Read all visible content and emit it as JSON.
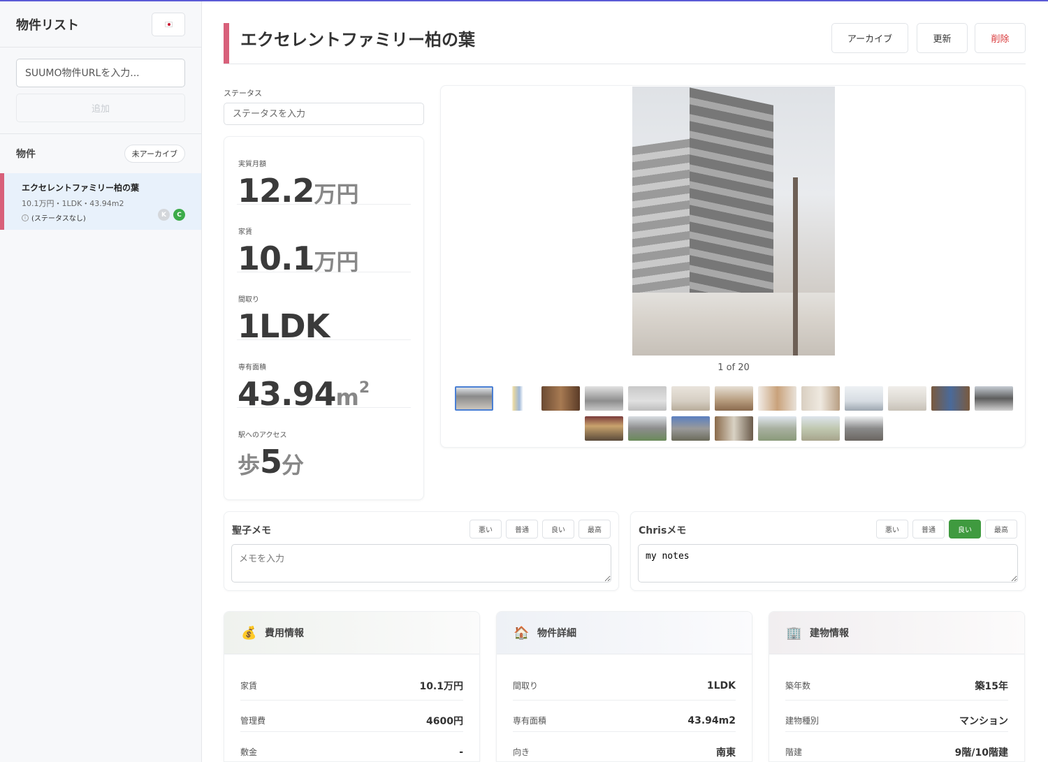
{
  "sidebar": {
    "title": "物件リスト",
    "url_placeholder": "SUUMO物件URLを入力...",
    "add_label": "追加",
    "section_title": "物件",
    "filter_label": "未アーカイブ",
    "items": [
      {
        "name": "エクセレントファミリー柏の葉",
        "meta": "10.1万円・1LDK・43.94m2",
        "status": "(ステータスなし)",
        "badges": [
          "K",
          "C"
        ]
      }
    ]
  },
  "header": {
    "title": "エクセレントファミリー柏の葉",
    "archive_label": "アーカイブ",
    "update_label": "更新",
    "delete_label": "削除"
  },
  "status": {
    "label": "ステータス",
    "placeholder": "ステータスを入力"
  },
  "stats": {
    "effective_rent": {
      "label": "実質月額",
      "value": "12.2",
      "unit": "万円"
    },
    "rent": {
      "label": "家賃",
      "value": "10.1",
      "unit": "万円"
    },
    "layout": {
      "label": "間取り",
      "value": "1LDK"
    },
    "area": {
      "label": "専有面積",
      "value": "43.94",
      "unit": "m",
      "sup": "2"
    },
    "access": {
      "label": "駅へのアクセス",
      "prefix": "歩",
      "value": "5",
      "unit": "分"
    }
  },
  "gallery": {
    "counter": "1 of 20",
    "current": 1,
    "total": 20
  },
  "memos": {
    "left": {
      "title": "聖子メモ",
      "ratings": [
        "悪い",
        "普通",
        "良い",
        "最高"
      ],
      "selected": null,
      "placeholder": "メモを入力",
      "value": ""
    },
    "right": {
      "title": "Chrisメモ",
      "ratings": [
        "悪い",
        "普通",
        "良い",
        "最高"
      ],
      "selected": "良い",
      "placeholder": "メモを入力",
      "value": "my notes"
    }
  },
  "cards": {
    "cost": {
      "icon": "money-bag-icon",
      "title": "費用情報",
      "rows": [
        {
          "label": "家賃",
          "value": "10.1万円"
        },
        {
          "label": "管理費",
          "value": "4600円"
        },
        {
          "label": "敷金",
          "value": "-"
        }
      ]
    },
    "details": {
      "icon": "house-icon",
      "title": "物件詳細",
      "rows": [
        {
          "label": "間取り",
          "value": "1LDK"
        },
        {
          "label": "専有面積",
          "value": "43.94m2"
        },
        {
          "label": "向き",
          "value": "南東"
        }
      ]
    },
    "building": {
      "icon": "office-building-icon",
      "title": "建物情報",
      "rows": [
        {
          "label": "築年数",
          "value": "築15年"
        },
        {
          "label": "建物種別",
          "value": "マンション"
        },
        {
          "label": "階建",
          "value": "9階/10階建"
        }
      ]
    }
  },
  "colors": {
    "accent_pink": "#d8607a",
    "selected_item_bg": "#e8f1fb",
    "rating_active": "#3f9a3f",
    "delete_red": "#d9383a",
    "thumb_active_border": "#4a7fd4"
  }
}
